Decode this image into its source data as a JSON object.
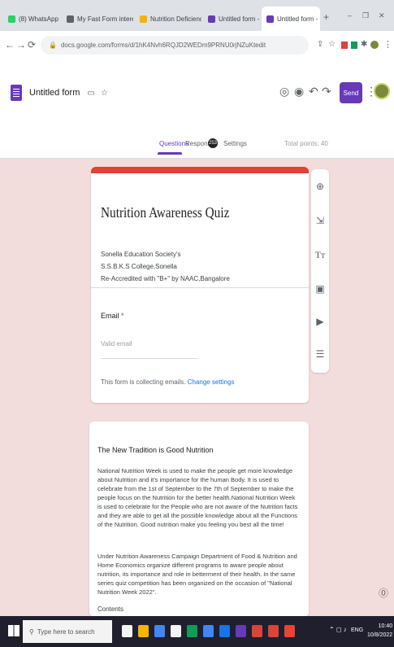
{
  "browser": {
    "tabs": [
      {
        "label": "(8) WhatsApp",
        "color": "#25d366"
      },
      {
        "label": "My Fast Form interest setting",
        "color": "#5f6368"
      },
      {
        "label": "Nutrition Deficiency Ex",
        "color": "#f4b400"
      },
      {
        "label": "Untitled form - Google Form",
        "color": "#673ab7"
      },
      {
        "label": "Untitled form - Google Form",
        "color": "#673ab7"
      }
    ],
    "new_tab": "+",
    "window_controls": [
      "–",
      "❐",
      "✕"
    ],
    "nav": {
      "back": "←",
      "forward": "→",
      "reload": "⟳"
    },
    "url": "docs.google.com/forms/d/1hK4Nvh6RQJD2WEDm9PRNU0rjNZuKtedit"
  },
  "header": {
    "doc_title": "Untitled form",
    "send_label": "Send",
    "tabs": {
      "questions": "Questions",
      "responses": "Responses",
      "responses_count": "253",
      "settings": "Settings"
    },
    "total_points": "Total points: 40"
  },
  "form": {
    "title": "Nutrition Awareness Quiz",
    "description_lines": [
      "Sonella Education Society's",
      "S.S.B.K.S College,Sonella",
      "Re-Accredited with \"B+\" by NAAC,Bangalore"
    ],
    "email_label": "Email",
    "email_required": "*",
    "email_placeholder": "Valid email",
    "collect_note": "This form is collecting emails.",
    "change_settings": "Change settings"
  },
  "article": {
    "title": "The New Tradition is Good Nutrition",
    "paragraphs": [
      "National Nutrition Week is used to make the people get more knowledge about Nutrition and it's importance for the human Body. It is used to celebrate from the 1st of September to the 7th of September to make the people focus on the Nutrition for the better health.National Nutrition Week is used to celebrate for the People who are not aware of the Nutrition facts and they are able to get all the possible knowledge about all the Functions of the Nutrition. Good nutrition make you feeling you best all the time!",
      "Under Nutrition Awareness Campaign Department of Food & Nutrition and Home Economics organize different programs to aware people about nutrition, its importance and role in betterment of their health. In the same series quiz competition has been organized on the occasion of \"National Nutrition Week 2022\"."
    ],
    "contents_label": "Contents"
  },
  "taskbar": {
    "search_placeholder": "Type here to search",
    "apps": [
      "#f3f3f3",
      "#f4b400",
      "#4285f4",
      "#f3f3f3",
      "#0f9d58",
      "#4285f4",
      "#1a73e8",
      "#673ab7",
      "#db4437",
      "#db4437",
      "#ea4335"
    ],
    "time": "10:40",
    "date": "10/8/2022",
    "lang": "ENG"
  }
}
